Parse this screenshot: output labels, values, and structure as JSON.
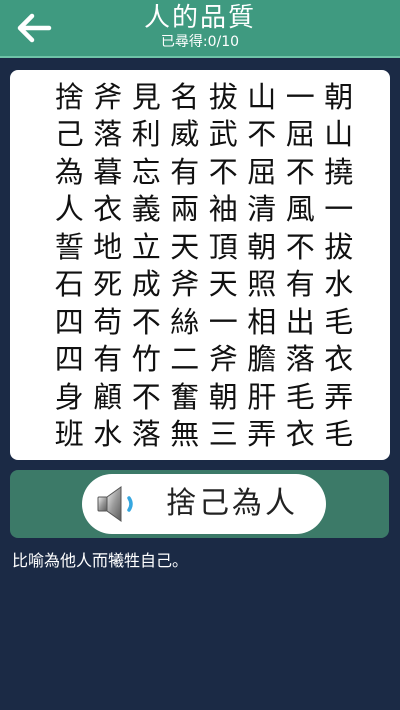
{
  "header": {
    "title": "人的品質",
    "progress": "已尋得:0/10",
    "back_icon": "arrow-left-icon"
  },
  "grid": {
    "rows": [
      [
        "捨",
        "斧",
        "見",
        "名",
        "拔",
        "山",
        "一",
        "朝"
      ],
      [
        "己",
        "落",
        "利",
        "威",
        "武",
        "不",
        "屈",
        "山"
      ],
      [
        "為",
        "暮",
        "忘",
        "有",
        "不",
        "屈",
        "不",
        "撓"
      ],
      [
        "人",
        "衣",
        "義",
        "兩",
        "袖",
        "清",
        "風",
        "一"
      ],
      [
        "誓",
        "地",
        "立",
        "天",
        "頂",
        "朝",
        "不",
        "拔"
      ],
      [
        "石",
        "死",
        "成",
        "斧",
        "天",
        "照",
        "有",
        "水"
      ],
      [
        "四",
        "苟",
        "不",
        "絲",
        "一",
        "相",
        "出",
        "毛"
      ],
      [
        "四",
        "有",
        "竹",
        "二",
        "斧",
        "膽",
        "落",
        "衣"
      ],
      [
        "身",
        "顧",
        "不",
        "奮",
        "朝",
        "肝",
        "毛",
        "弄"
      ],
      [
        "班",
        "水",
        "落",
        "無",
        "三",
        "弄",
        "衣",
        "毛"
      ]
    ]
  },
  "answer": {
    "word": "捨己為人",
    "speaker_icon": "speaker-icon"
  },
  "definition": "比喻為他人而犧牲自己。",
  "colors": {
    "header_bg": "#3f9a80",
    "page_bg": "#1b2a45",
    "answer_bar_bg": "#3c7a68"
  }
}
